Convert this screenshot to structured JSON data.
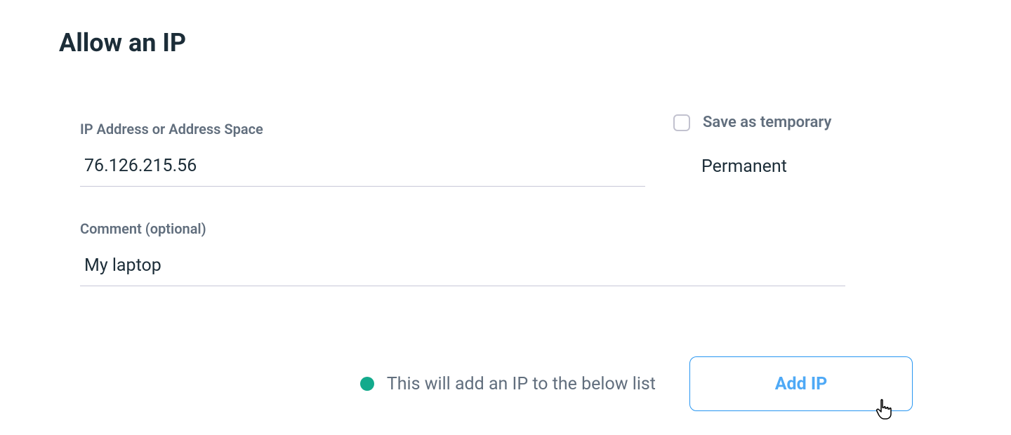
{
  "title": "Allow an IP",
  "ipField": {
    "label": "IP Address or Address Space",
    "value": "76.126.215.56"
  },
  "commentField": {
    "label": "Comment (optional)",
    "value": "My laptop"
  },
  "temporaryCheckbox": {
    "label": "Save as temporary",
    "checked": false
  },
  "durationValue": "Permanent",
  "helper": {
    "text": "This will add an IP to the below list"
  },
  "addButton": {
    "label": "Add IP"
  }
}
